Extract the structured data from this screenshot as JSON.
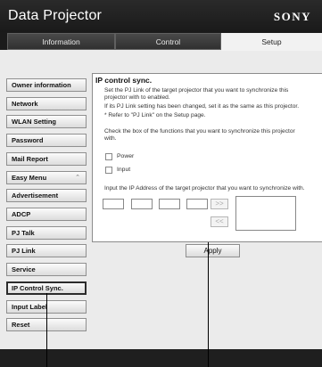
{
  "header": {
    "title": "Data Projector",
    "brand": "SONY"
  },
  "tabs": [
    {
      "label": "Information"
    },
    {
      "label": "Control"
    },
    {
      "label": "Setup"
    }
  ],
  "sidebar": {
    "items": [
      {
        "label": "Owner information"
      },
      {
        "label": "Network"
      },
      {
        "label": "WLAN Setting"
      },
      {
        "label": "Password"
      },
      {
        "label": "Mail Report"
      },
      {
        "label": "Easy Menu",
        "icon": "chevron-up-icon"
      },
      {
        "label": "Advertisement"
      },
      {
        "label": "ADCP"
      },
      {
        "label": "PJ Talk"
      },
      {
        "label": "PJ Link"
      },
      {
        "label": "Service"
      },
      {
        "label": "IP Control Sync."
      },
      {
        "label": "Input Label"
      },
      {
        "label": "Reset"
      }
    ],
    "active": "IP Control Sync."
  },
  "content": {
    "title": "IP control sync.",
    "description_line1": "Set the PJ Link of the target projector that you want to synchronize this",
    "description_line2": "projector with to enabled.",
    "note_line1": "If its PJ Link setting has been changed, set it as the same as this projector.",
    "note_line2": "* Refer to \"PJ Link\" on the Setup page.",
    "check_instruction_line1": "Check the box of the functions that you want to synchronize this projector",
    "check_instruction_line2": "with.",
    "options": [
      {
        "label": "Power",
        "checked": false
      },
      {
        "label": "Input",
        "checked": false
      }
    ],
    "ip_instruction": "Input the IP Address of the target projector that you want to synchronize with.",
    "add_button": ">>",
    "remove_button": "<<"
  },
  "apply_label": "Apply"
}
